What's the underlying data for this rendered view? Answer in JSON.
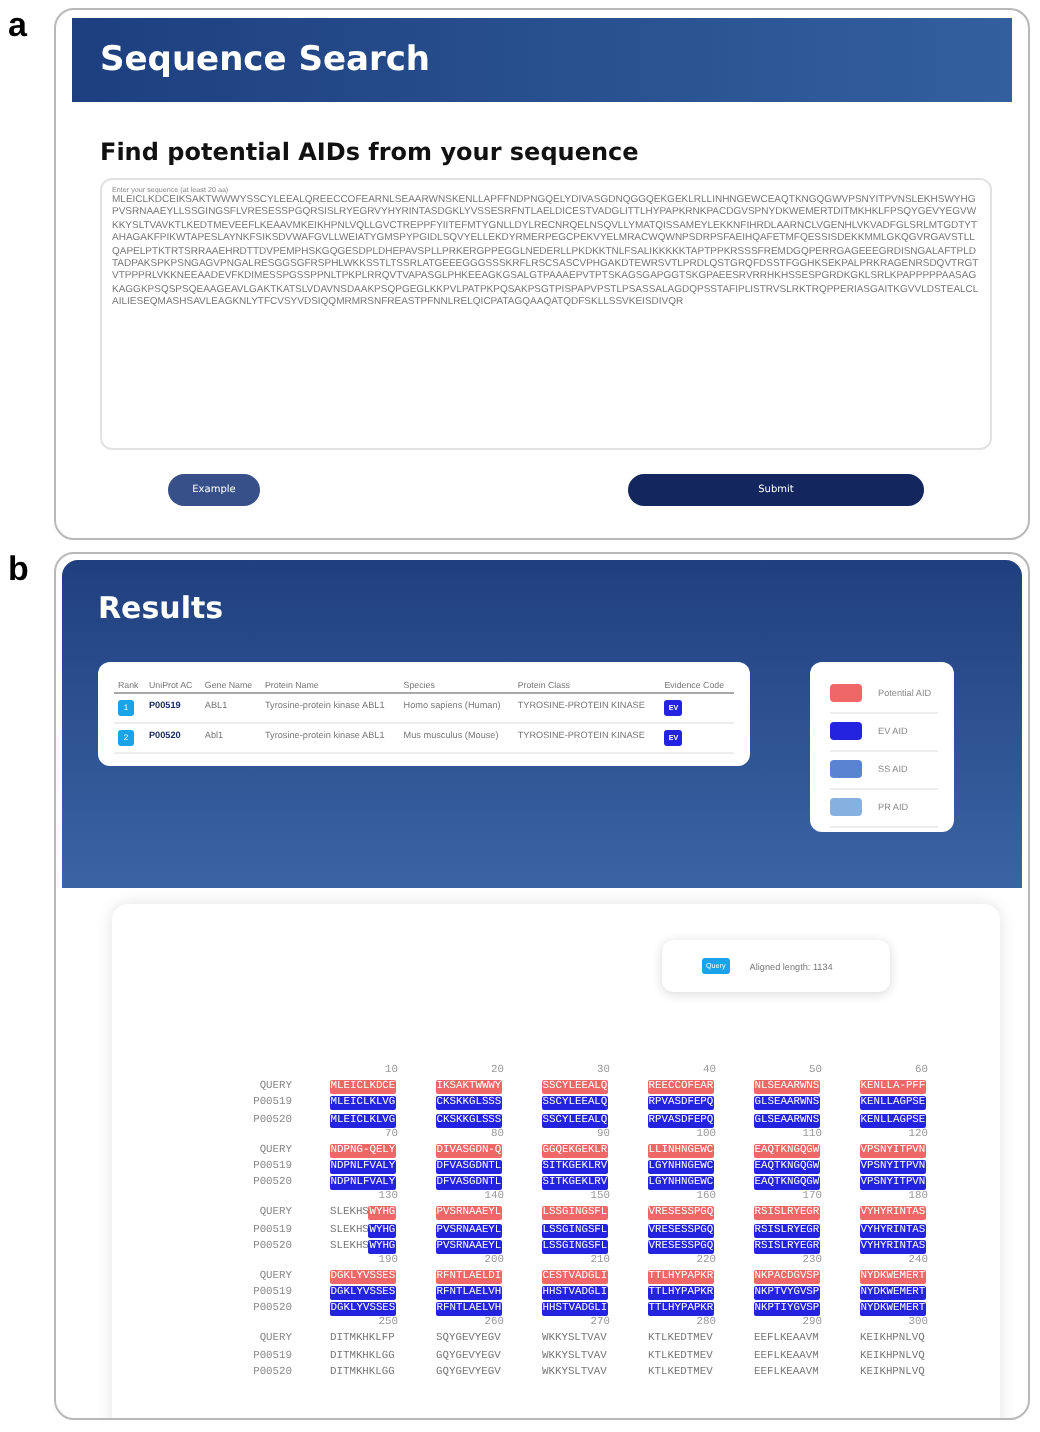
{
  "panel_a": {
    "label": "a",
    "header": {
      "title": "Sequence Search"
    },
    "heading": "Find potential AIDs from your sequence",
    "sequence_field": {
      "placeholder": "Enter your sequence (at least 20 aa)",
      "value": "MLEICLKDCEIKSAKTWWWYSSCYLEEALQREECCOFEARNLSEAARWNSKENLLAPFFNDPNGQELYDIVASGDNQGGQEKGEKLRLLINHNGEWCEAQTKNGQGWVPSNYITPVNSLEKHSWYHGPVSRNAAEYLLSSGINGSFLVRESESSPGQRSISLRYEGRVYHYRINTASDGKLYVSSESRFNTLAELDICESTVADGLITTLHYPAPKRNKPACDGVSPNYDKWEMERTDITMKHKLFPSQYGEVYEGVWKKYSLTVAVKTLKEDTMEVEEFLKEAAVMKEIKHPNLVQLLGVCTREPPFYIITEFMTYGNLLDYLRECNRQELNSQVLLYMATQISSAMEYLEKKNFIHRDLAARNCLVGENHLVKVADFGLSRLMTGDTYTAHAGAKFPIKWTAPESLAYNKFSIKSDVWAFGVLLWEIATYGMSPYPGIDLSQVYELLEKDYRMERPEGCPEKVYELMRACWQWNPSDRPSFAEIHQAFETMFQESSISDEKKMMLGKQGVRGAVSTLLQAPELPTKTRTSRRAAEHRDTTDVPEMPHSKGQGESDPLDHEPAVSPLLPRKERGPPEGGLNEDERLLPKDKKTNLFSALIKKKKKTAPTPPKRSSSFREMDGQPERRGAGEEEGRDISNGALAFTPLDTADPAKSPKPSNGAGVPNGALRESGGSGFRSPHLWKKSSTLTSSRLATGEEEGGGSSSKRFLRSCSASCVPHGAKDTEWRSVTLPRDLQSTGRQFDSSTFGGHKSEKPALPRKRAGENRSDQVTRGTVTPPPRLVKKNEEAADEVFKDIMESSPGSSPPNLTPKPLRRQVTVAPASGLPHKEEAGKGSALGTPAAAEPVTPTSKAGSGAPGGTSKGPAEESRVRRHKHSSESPGRDKGKLSRLKPAPPPPPAASAGKAGGKPSQSPSQEAAGEAVLGAKTKATSLVDAVNSDAAKPSQPGEGLKKPVLPATPKPQSAKPSGTPISPAPVPSTLPSASSALAGDQPSSTAFIPLISTRVSLRKTRQPPERIASGAITKGVVLDSTEALCLAILIESEQMASHSAVLEAGKNLYTFCVSYVDSIQQMRMRSNFREASTPFNNLRELQICPATAGQAAQATQDFSKLLSSVKEISDIVQR"
    },
    "buttons": [
      {
        "label": "Example",
        "kind": "secondary"
      },
      {
        "label": "Submit",
        "kind": "primary"
      }
    ]
  },
  "panel_b": {
    "label": "b",
    "title": "Results",
    "table": {
      "columns": [
        "Rank",
        "UniProt AC",
        "Gene Name",
        "Protein Name",
        "Species",
        "Protein Class",
        "Evidence Code"
      ],
      "rows": [
        {
          "rank": "1",
          "accession": "P00519",
          "gene": "ABL1",
          "protein": "Tyrosine-protein kinase ABL1",
          "species": "Homo sapiens (Human)",
          "class": "TYROSINE-PROTEIN KINASE",
          "evidence": "EV"
        },
        {
          "rank": "2",
          "accession": "P00520",
          "gene": "Abl1",
          "protein": "Tyrosine-protein kinase ABL1",
          "species": "Mus musculus (Mouse)",
          "class": "TYROSINE-PROTEIN KINASE",
          "evidence": "EV"
        }
      ]
    },
    "legend": [
      {
        "label": "Potential AID",
        "color": "#f06767"
      },
      {
        "label": "EV AID",
        "color": "#2424e0"
      },
      {
        "label": "SS AID",
        "color": "#5a84d2"
      },
      {
        "label": "PR AID",
        "color": "#86b0e0"
      }
    ],
    "alignment": {
      "badge": "Query",
      "aligned_length": "Aligned length: 1134",
      "groups": [
        {
          "ruler": [
            "10",
            "20",
            "30",
            "40",
            "50",
            "60"
          ],
          "rows": [
            {
              "name": "QUERY",
              "kind": "potential",
              "blocks": [
                [
                  [
                    "MLEICLKDCE",
                    true
                  ]
                ],
                [
                  [
                    "IKSAKTWWWY",
                    true
                  ]
                ],
                [
                  [
                    "SSCYLEEALQ",
                    true
                  ]
                ],
                [
                  [
                    "REECCOFEAR",
                    true
                  ]
                ],
                [
                  [
                    "NLSEAARWNS",
                    true
                  ]
                ],
                [
                  [
                    "KENLLA-PFF",
                    true
                  ]
                ]
              ]
            },
            {
              "name": "P00519",
              "kind": "ev",
              "blocks": [
                [
                  [
                    "MLEICLKLVG",
                    true
                  ]
                ],
                [
                  [
                    "CKSKKGLSSS",
                    true
                  ]
                ],
                [
                  [
                    "SSCYLEEALQ",
                    true
                  ]
                ],
                [
                  [
                    "RPVASDFEPQ",
                    true
                  ]
                ],
                [
                  [
                    "GLSEAARWNS",
                    true
                  ]
                ],
                [
                  [
                    "KENLLAGPSE",
                    true
                  ]
                ]
              ]
            },
            {
              "name": "P00520",
              "kind": "ev",
              "blocks": [
                [
                  [
                    "MLEICLKLVG",
                    true
                  ]
                ],
                [
                  [
                    "CKSKKGLSSS",
                    true
                  ]
                ],
                [
                  [
                    "SSCYLEEALQ",
                    true
                  ]
                ],
                [
                  [
                    "RPVASDFEPQ",
                    true
                  ]
                ],
                [
                  [
                    "GLSEAARWNS",
                    true
                  ]
                ],
                [
                  [
                    "KENLLAGPSE",
                    true
                  ]
                ]
              ]
            }
          ]
        },
        {
          "ruler": [
            "70",
            "80",
            "90",
            "100",
            "110",
            "120"
          ],
          "rows": [
            {
              "name": "QUERY",
              "kind": "potential",
              "blocks": [
                [
                  [
                    "NDPNG-QELY",
                    true
                  ]
                ],
                [
                  [
                    "DIVASGDN-Q",
                    true
                  ]
                ],
                [
                  [
                    "GGQEKGEKLR",
                    true
                  ]
                ],
                [
                  [
                    "LLINHNGEWC",
                    true
                  ]
                ],
                [
                  [
                    "EAQTKNGQGW",
                    true
                  ]
                ],
                [
                  [
                    "VPSNYITPVN",
                    true
                  ]
                ]
              ]
            },
            {
              "name": "P00519",
              "kind": "ev",
              "blocks": [
                [
                  [
                    "NDPNLFVALY",
                    true
                  ]
                ],
                [
                  [
                    "DFVASGDNTL",
                    true
                  ]
                ],
                [
                  [
                    "SITKGEKLRV",
                    true
                  ]
                ],
                [
                  [
                    "LGYNHNGEWC",
                    true
                  ]
                ],
                [
                  [
                    "EAQTKNGQGW",
                    true
                  ]
                ],
                [
                  [
                    "VPSNYITPVN",
                    true
                  ]
                ]
              ]
            },
            {
              "name": "P00520",
              "kind": "ev",
              "blocks": [
                [
                  [
                    "NDPNLFVALY",
                    true
                  ]
                ],
                [
                  [
                    "DFVASGDNTL",
                    true
                  ]
                ],
                [
                  [
                    "SITKGEKLRV",
                    true
                  ]
                ],
                [
                  [
                    "LGYNHNGEWC",
                    true
                  ]
                ],
                [
                  [
                    "EAQTKNGQGW",
                    true
                  ]
                ],
                [
                  [
                    "VPSNYITPVN",
                    true
                  ]
                ]
              ]
            }
          ]
        },
        {
          "ruler": [
            "130",
            "140",
            "150",
            "160",
            "170",
            "180"
          ],
          "rows": [
            {
              "name": "QUERY",
              "kind": "potential",
              "blocks": [
                [
                  [
                    "SLEKHS",
                    false
                  ],
                  [
                    "WYHG",
                    true
                  ]
                ],
                [
                  [
                    "PVSRNAAEYL",
                    true
                  ]
                ],
                [
                  [
                    "LSSGINGSFL",
                    true
                  ]
                ],
                [
                  [
                    "VRESESSPGQ",
                    true
                  ]
                ],
                [
                  [
                    "RSISLRYEGR",
                    true
                  ]
                ],
                [
                  [
                    "VYHYRINTAS",
                    true
                  ]
                ]
              ]
            },
            {
              "name": "P00519",
              "kind": "ev",
              "blocks": [
                [
                  [
                    "SLEKHS",
                    false
                  ],
                  [
                    "WYHG",
                    true
                  ]
                ],
                [
                  [
                    "PVSRNAAEYL",
                    true
                  ]
                ],
                [
                  [
                    "LSSGINGSFL",
                    true
                  ]
                ],
                [
                  [
                    "VRESESSPGQ",
                    true
                  ]
                ],
                [
                  [
                    "RSISLRYEGR",
                    true
                  ]
                ],
                [
                  [
                    "VYHYRINTAS",
                    true
                  ]
                ]
              ]
            },
            {
              "name": "P00520",
              "kind": "ev",
              "blocks": [
                [
                  [
                    "SLEKHS",
                    false
                  ],
                  [
                    "WYHG",
                    true
                  ]
                ],
                [
                  [
                    "PVSRNAAEYL",
                    true
                  ]
                ],
                [
                  [
                    "LSSGINGSFL",
                    true
                  ]
                ],
                [
                  [
                    "VRESESSPGQ",
                    true
                  ]
                ],
                [
                  [
                    "RSISLRYEGR",
                    true
                  ]
                ],
                [
                  [
                    "VYHYRINTAS",
                    true
                  ]
                ]
              ]
            }
          ]
        },
        {
          "ruler": [
            "190",
            "200",
            "210",
            "220",
            "230",
            "240"
          ],
          "rows": [
            {
              "name": "QUERY",
              "kind": "potential",
              "blocks": [
                [
                  [
                    "DGKLYVSSES",
                    true
                  ]
                ],
                [
                  [
                    "RFNTLAELDI",
                    true
                  ]
                ],
                [
                  [
                    "CESTVADGLI",
                    true
                  ]
                ],
                [
                  [
                    "TTLHYPAPKR",
                    true
                  ]
                ],
                [
                  [
                    "NKPACDGVSP",
                    true
                  ]
                ],
                [
                  [
                    "NYDKWEMERT",
                    true
                  ]
                ]
              ]
            },
            {
              "name": "P00519",
              "kind": "ev",
              "blocks": [
                [
                  [
                    "DGKLYVSSES",
                    true
                  ]
                ],
                [
                  [
                    "RFNTLAELVH",
                    true
                  ]
                ],
                [
                  [
                    "HHSTVADGLI",
                    true
                  ]
                ],
                [
                  [
                    "TTLHYPAPKR",
                    true
                  ]
                ],
                [
                  [
                    "NKPTVYGVSP",
                    true
                  ]
                ],
                [
                  [
                    "NYDKWEMERT",
                    true
                  ]
                ]
              ]
            },
            {
              "name": "P00520",
              "kind": "ev",
              "blocks": [
                [
                  [
                    "DGKLYVSSES",
                    true
                  ]
                ],
                [
                  [
                    "RFNTLAELVH",
                    true
                  ]
                ],
                [
                  [
                    "HHSTVADGLI",
                    true
                  ]
                ],
                [
                  [
                    "TTLHYPAPKR",
                    true
                  ]
                ],
                [
                  [
                    "NKPTIYGVSP",
                    true
                  ]
                ],
                [
                  [
                    "NYDKWEMERT",
                    true
                  ]
                ]
              ]
            }
          ]
        },
        {
          "ruler": [
            "250",
            "260",
            "270",
            "280",
            "290",
            "300"
          ],
          "rows": [
            {
              "name": "QUERY",
              "blocks": [
                [
                  [
                    "DITMKHKLFP",
                    false
                  ]
                ],
                [
                  [
                    "SQYGEVYEGV",
                    false
                  ]
                ],
                [
                  [
                    "WKKYSLTVAV",
                    false
                  ]
                ],
                [
                  [
                    "KTLKEDTMEV",
                    false
                  ]
                ],
                [
                  [
                    "EEFLKEAAVM",
                    false
                  ]
                ],
                [
                  [
                    "KEIKHPNLVQ",
                    false
                  ]
                ]
              ]
            },
            {
              "name": "P00519",
              "blocks": [
                [
                  [
                    "DITMKHKLGG",
                    false
                  ]
                ],
                [
                  [
                    "GQYGEVYEGV",
                    false
                  ]
                ],
                [
                  [
                    "WKKYSLTVAV",
                    false
                  ]
                ],
                [
                  [
                    "KTLKEDTMEV",
                    false
                  ]
                ],
                [
                  [
                    "EEFLKEAAVM",
                    false
                  ]
                ],
                [
                  [
                    "KEIKHPNLVQ",
                    false
                  ]
                ]
              ]
            },
            {
              "name": "P00520",
              "blocks": [
                [
                  [
                    "DITMKHKLGG",
                    false
                  ]
                ],
                [
                  [
                    "GQYGEVYEGV",
                    false
                  ]
                ],
                [
                  [
                    "WKKYSLTVAV",
                    false
                  ]
                ],
                [
                  [
                    "KTLKEDTMEV",
                    false
                  ]
                ],
                [
                  [
                    "EEFLKEAAVM",
                    false
                  ]
                ],
                [
                  [
                    "KEIKHPNLVQ",
                    false
                  ]
                ]
              ]
            }
          ]
        }
      ]
    }
  }
}
